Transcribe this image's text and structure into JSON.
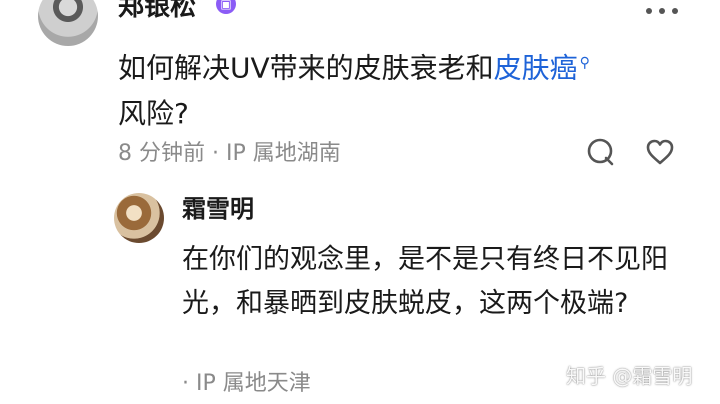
{
  "main_comment": {
    "username": "郑银松",
    "badge_icon": "verified-badge-icon",
    "text_before_link": "如何解决UV带来的皮肤衰老和",
    "link_text": "皮肤癌",
    "link_icon": "search-icon",
    "text_after_link": "风险?",
    "meta": "8 分钟前 · IP 属地湖南"
  },
  "reply_comment": {
    "username": "霜雪明",
    "text": "在你们的观念里，是不是只有终日不见阳光，和暴晒到皮肤蜕皮，这两个极端?",
    "meta": "· IP 属地天津"
  },
  "watermark": "知乎 @霜雪明",
  "colors": {
    "link": "#1e63d8",
    "meta": "#8a8a8a",
    "badge": "#8b5cf6"
  }
}
